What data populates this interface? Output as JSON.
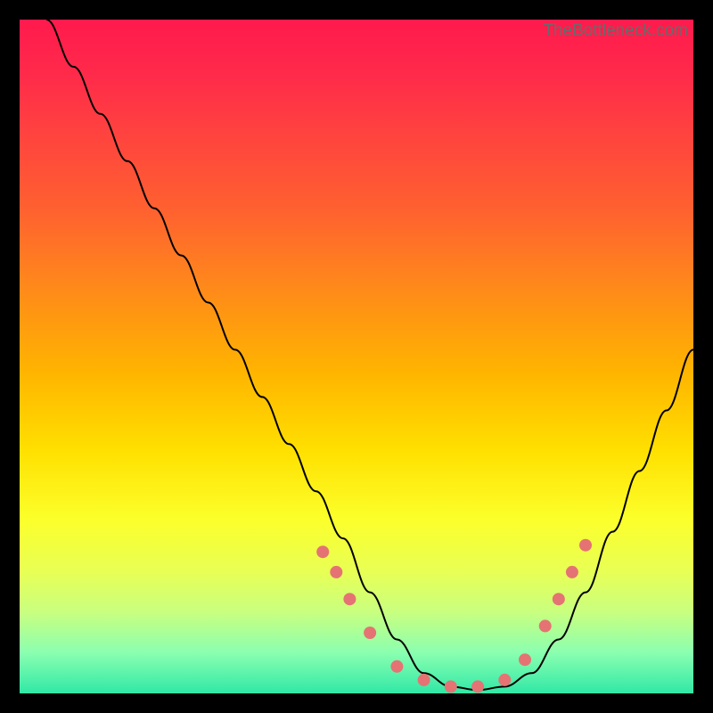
{
  "attribution": "TheBottleneck.com",
  "chart_data": {
    "type": "line",
    "title": "",
    "xlabel": "",
    "ylabel": "",
    "xlim": [
      0,
      100
    ],
    "ylim": [
      0,
      100
    ],
    "series": [
      {
        "name": "curve",
        "x": [
          4,
          8,
          12,
          16,
          20,
          24,
          28,
          32,
          36,
          40,
          44,
          48,
          52,
          56,
          60,
          64,
          68,
          72,
          76,
          80,
          84,
          88,
          92,
          96,
          100
        ],
        "y": [
          100,
          93,
          86,
          79,
          72,
          65,
          58,
          51,
          44,
          37,
          30,
          23,
          15,
          8,
          3,
          1,
          0.5,
          1,
          3,
          8,
          15,
          24,
          33,
          42,
          51
        ]
      }
    ],
    "markers": {
      "name": "dots",
      "x": [
        45,
        47,
        49,
        52,
        56,
        60,
        64,
        68,
        72,
        75,
        78,
        80,
        82,
        84
      ],
      "y": [
        21,
        18,
        14,
        9,
        4,
        2,
        1,
        1,
        2,
        5,
        10,
        14,
        18,
        22
      ]
    },
    "colors": {
      "gradient_top": "#ff1a4d",
      "gradient_mid": "#ffe000",
      "gradient_bottom": "#30e8a6",
      "curve": "#000000",
      "dots": "#e57373"
    }
  }
}
